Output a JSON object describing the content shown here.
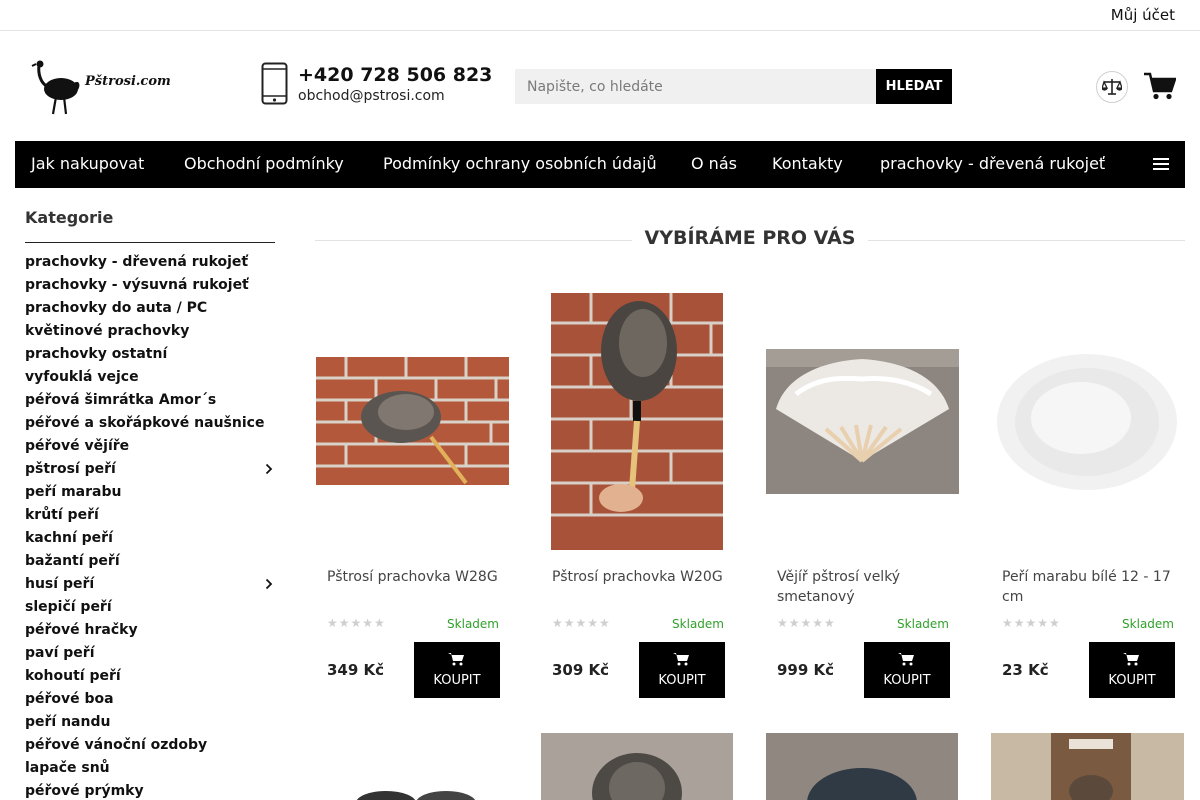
{
  "topbar": {
    "account_label": "Můj účet"
  },
  "header": {
    "logo_text": "Pštrosi.com",
    "phone": "+420 728 506 823",
    "email": "obchod@pstrosi.com",
    "search": {
      "placeholder": "Napište, co hledáte",
      "button_label": "HLEDAT"
    }
  },
  "nav": {
    "items": [
      "Jak nakupovat",
      "Obchodní podmínky",
      "Podmínky ochrany osobních údajů",
      "O nás",
      "Kontakty",
      "prachovky - dřevená rukojeť"
    ]
  },
  "sidebar": {
    "title": "Kategorie",
    "categories": [
      "prachovky - dřevená rukojeť",
      "prachovky - výsuvná rukojeť",
      "prachovky do auta / PC",
      "květinové prachovky",
      "prachovky ostatní",
      "vyfouklá vejce",
      "péřová šimrátka Amor´s",
      "péřové a skořápkové naušnice",
      "péřové vějíře",
      "pštrosí peří",
      "peří marabu",
      "krůtí peří",
      "kachní peří",
      "bažantí peří",
      "husí peří",
      "slepičí peří",
      "péřové hračky",
      "paví peří",
      "kohoutí peří",
      "péřové boa",
      "peří nandu",
      "péřové vánoční ozdoby",
      "lapače snů",
      "péřové prýmky"
    ]
  },
  "main": {
    "section_title": "VYBÍRÁME PRO VÁS",
    "buy_label": "KOUPIT",
    "products": [
      {
        "name": "Pštrosí prachovka W28G",
        "rating": "★★★★★",
        "stock": "Skladem",
        "price": "349 Kč"
      },
      {
        "name": "Pštrosí prachovka W20G",
        "rating": "★★★★★",
        "stock": "Skladem",
        "price": "309 Kč"
      },
      {
        "name": "Vějíř pštrosí velký smetanový",
        "rating": "★★★★★",
        "stock": "Skladem",
        "price": "999 Kč"
      },
      {
        "name": "Peří marabu bílé 12 - 17 cm",
        "rating": "★★★★★",
        "stock": "Skladem",
        "price": "23 Kč"
      }
    ]
  },
  "colors": {
    "nav_bg": "#000000",
    "button_bg": "#000000",
    "stock_green": "#31a02c",
    "search_bg": "#f0f0f0"
  }
}
